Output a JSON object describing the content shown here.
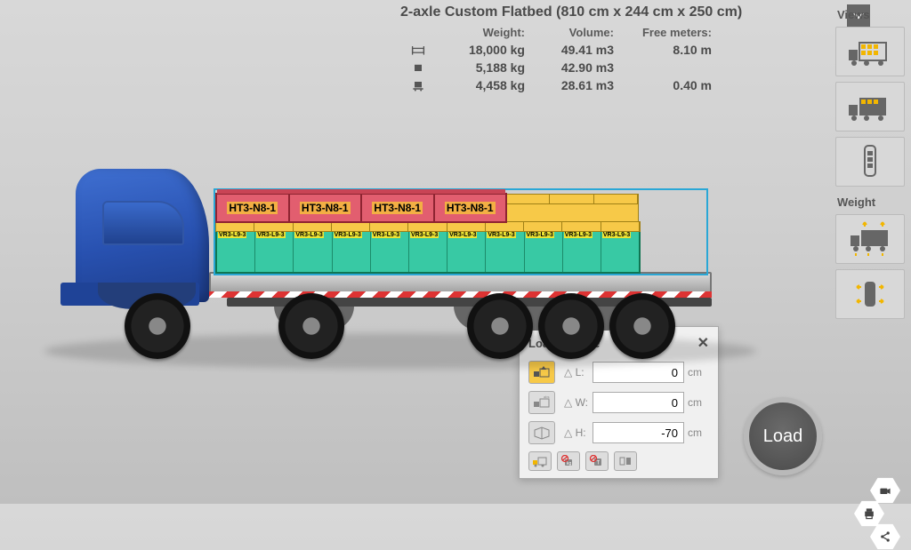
{
  "header": {
    "title": "2-axle Custom Flatbed (810 cm x 244 cm x 250 cm)",
    "columns": {
      "weight": "Weight:",
      "volume": "Volume:",
      "free": "Free meters:"
    },
    "rows": [
      {
        "icon": "capacity",
        "weight": "18,000 kg",
        "volume": "49.41 m3",
        "free": "8.10 m"
      },
      {
        "icon": "loaded",
        "weight": "5,188 kg",
        "volume": "42.90 m3",
        "free": ""
      },
      {
        "icon": "remaining",
        "weight": "4,458 kg",
        "volume": "28.61 m3",
        "free": "0.40 m"
      }
    ]
  },
  "views": {
    "label": "Views"
  },
  "weight": {
    "label": "Weight"
  },
  "load_button": "Load",
  "dialog": {
    "title": "Loading Size",
    "rows": [
      {
        "label": "△ L:",
        "value": "0",
        "unit": "cm",
        "active": true
      },
      {
        "label": "△ W:",
        "value": "0",
        "unit": "cm",
        "active": false
      },
      {
        "label": "△ H:",
        "value": "-70",
        "unit": "cm",
        "active": false
      }
    ]
  },
  "cargo": {
    "red_label": "HT3-N8-1",
    "green_label": "VR3-L9-3"
  }
}
